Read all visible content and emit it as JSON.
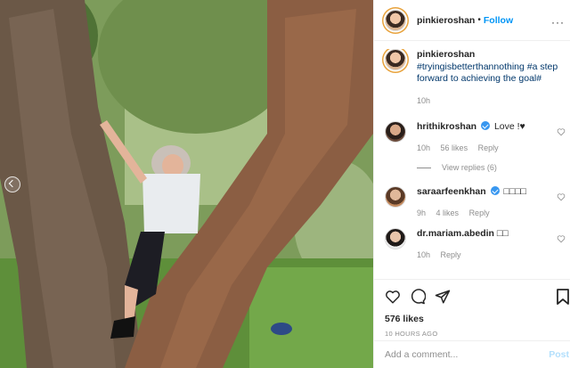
{
  "post": {
    "username": "pinkieroshan",
    "follow_label": "Follow",
    "separator": "•",
    "more_label": "···",
    "caption_username": "pinkieroshan",
    "caption_text": "#tryingisbetterthannothing #a step forward to achieving the goal#",
    "caption_time": "10h",
    "likes": "576 likes",
    "posted_ago": "10 HOURS AGO"
  },
  "comments": [
    {
      "username": "hrithikroshan",
      "verified": true,
      "text": "Love !",
      "time": "10h",
      "likes": "56 likes",
      "reply": "Reply",
      "view_replies": "View replies (6)"
    },
    {
      "username": "saraarfeenkhan",
      "verified": true,
      "text": "□□□□",
      "time": "9h",
      "likes": "4 likes",
      "reply": "Reply"
    },
    {
      "username": "dr.mariam.abedin",
      "verified": false,
      "text": "□□",
      "time": "10h",
      "reply": "Reply"
    }
  ],
  "composer": {
    "placeholder": "Add a comment...",
    "post_label": "Post"
  },
  "icons": [
    "heart-icon",
    "comment-icon",
    "share-icon",
    "bookmark-icon",
    "more-icon",
    "verified-icon",
    "carousel-prev-icon"
  ],
  "colors": {
    "link": "#0095f6",
    "hashtag": "#00376b",
    "muted": "#8e8e8e",
    "verified": "#3897f0"
  }
}
